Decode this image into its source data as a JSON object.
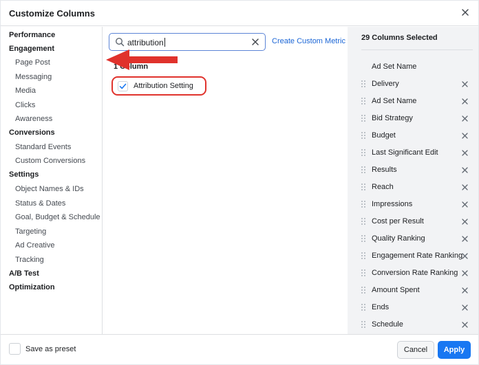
{
  "dialog": {
    "title": "Customize Columns"
  },
  "left_nav": [
    {
      "label": "Performance",
      "kind": "group"
    },
    {
      "label": "Engagement",
      "kind": "group"
    },
    {
      "label": "Page Post",
      "kind": "sub"
    },
    {
      "label": "Messaging",
      "kind": "sub"
    },
    {
      "label": "Media",
      "kind": "sub"
    },
    {
      "label": "Clicks",
      "kind": "sub"
    },
    {
      "label": "Awareness",
      "kind": "sub"
    },
    {
      "label": "Conversions",
      "kind": "group"
    },
    {
      "label": "Standard Events",
      "kind": "sub"
    },
    {
      "label": "Custom Conversions",
      "kind": "sub"
    },
    {
      "label": "Settings",
      "kind": "group"
    },
    {
      "label": "Object Names & IDs",
      "kind": "sub"
    },
    {
      "label": "Status & Dates",
      "kind": "sub"
    },
    {
      "label": "Goal, Budget & Schedule",
      "kind": "sub"
    },
    {
      "label": "Targeting",
      "kind": "sub"
    },
    {
      "label": "Ad Creative",
      "kind": "sub"
    },
    {
      "label": "Tracking",
      "kind": "sub"
    },
    {
      "label": "A/B Test",
      "kind": "group"
    },
    {
      "label": "Optimization",
      "kind": "group"
    }
  ],
  "search": {
    "value": "attribution",
    "create_link": "Create Custom Metric"
  },
  "results": {
    "count_label": "1 Column",
    "items": [
      {
        "label": "Attribution Setting",
        "checked": true
      }
    ]
  },
  "selected": {
    "title": "29 Columns Selected",
    "fixed_column": "Ad Set Name",
    "columns": [
      "Delivery",
      "Ad Set Name",
      "Bid Strategy",
      "Budget",
      "Last Significant Edit",
      "Results",
      "Reach",
      "Impressions",
      "Cost per Result",
      "Quality Ranking",
      "Engagement Rate Ranking",
      "Conversion Rate Ranking",
      "Amount Spent",
      "Ends",
      "Schedule"
    ]
  },
  "footer": {
    "preset_label": "Save as preset",
    "cancel_label": "Cancel",
    "apply_label": "Apply"
  },
  "colors": {
    "accent": "#1877f2",
    "link": "#1a65d6",
    "highlight": "#e0322c",
    "panel": "#f2f3f5"
  },
  "icons": {
    "close": "close-icon",
    "search": "search-icon",
    "clear": "clear-icon",
    "check": "checkmark-icon",
    "drag": "drag-handle-icon",
    "remove": "remove-icon",
    "annotation": "red-arrow-annotation"
  }
}
